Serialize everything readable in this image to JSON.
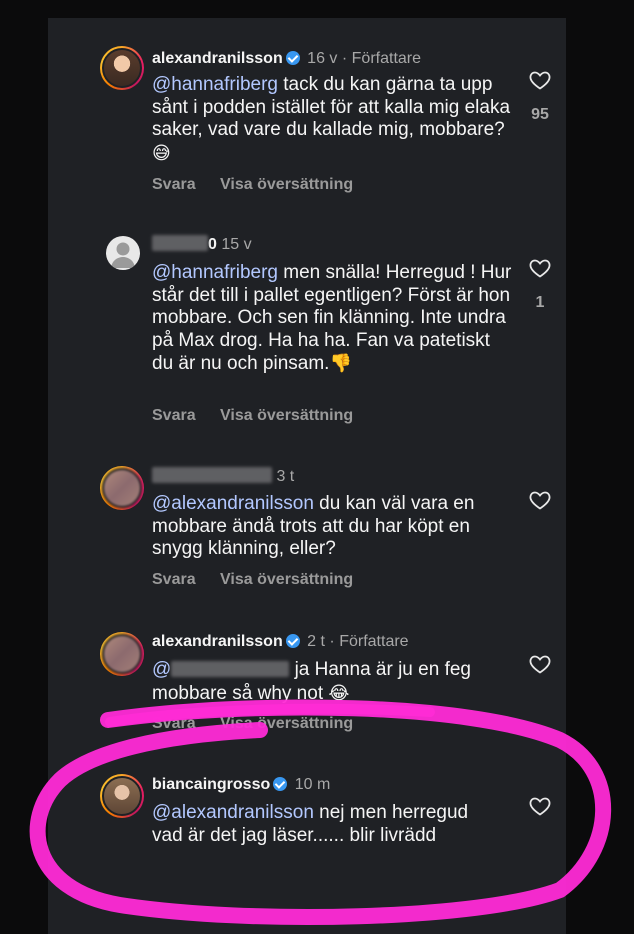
{
  "comments": [
    {
      "username": "alexandranilsson",
      "verified": true,
      "time": "16 v",
      "sep": "·",
      "badge": "Författare",
      "mention": "@hannafriberg",
      "text": " tack du kan gärna ta upp sånt i podden istället för att kalla mig elaka saker, vad vare du kallade mig, mobbare? ",
      "emoji": "😅",
      "reply": "Svara",
      "translate": "Visa översättning",
      "likes": "95"
    },
    {
      "username": "",
      "username_visible_tail": "0",
      "time": "15 v",
      "mention": "@hannafriberg",
      "text": " men snälla! Herregud ! Hur står det till i pallet egentligen? Först är hon mobbare. Och sen fin klänning. Inte undra på Max drog. Ha ha ha. Fan va patetiskt du är nu och pinsam.",
      "emoji": "👎",
      "reply": "Svara",
      "translate": "Visa översättning",
      "likes": "1"
    },
    {
      "username": "",
      "time": "3 t",
      "mention": "@alexandranilsson",
      "text": " du kan väl vara en mobbare ändå trots att du har köpt en snygg klänning, eller?",
      "reply": "Svara",
      "translate": "Visa översättning"
    },
    {
      "username": "alexandranilsson",
      "verified": true,
      "time": "2 t",
      "sep": "·",
      "badge": "Författare",
      "mention": "@",
      "text": "ja Hanna är ju en feg mobbare så why not ",
      "emoji": "😂",
      "reply": "Svara",
      "translate": "Visa översättning"
    },
    {
      "username": "biancaingrosso",
      "verified": true,
      "time": "10 m",
      "mention": "@alexandranilsson",
      "text": " nej men herregud vad är det jag läser...... blir livrädd"
    }
  ],
  "icons": {
    "like": "heart-outline-icon",
    "verified": "verified-badge-icon"
  },
  "colors": {
    "background": "#1f2125",
    "mention": "#b3c8ff",
    "highlight": "#ff2bd6"
  }
}
